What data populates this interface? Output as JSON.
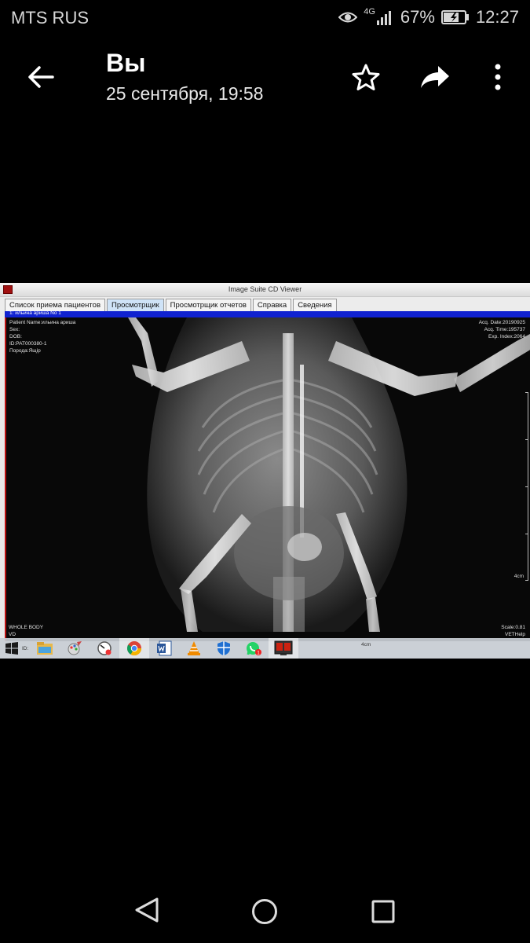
{
  "status_bar": {
    "carrier": "MTS RUS",
    "network": "4G",
    "battery": "67%",
    "time": "12:27"
  },
  "app_bar": {
    "title": "Вы",
    "subtitle": "25 сентября, 19:58",
    "icons": [
      "back-arrow-icon",
      "star-icon",
      "share-icon",
      "more-vert-icon"
    ]
  },
  "photo": {
    "window_title": "Image Suite CD Viewer",
    "tabs": [
      {
        "label": "Список приема пациентов"
      },
      {
        "label": "Просмотрщик"
      },
      {
        "label": "Просмотрщик отчетов"
      },
      {
        "label": "Справка"
      },
      {
        "label": "Сведения"
      }
    ],
    "active_tab": 1,
    "patient_strip": "1: ильина ариша     No 1",
    "overlay_left": {
      "patient_name": "Patient Name:ильина ариша",
      "sex": "Sex:",
      "dob": "DOB:",
      "id": "ID:PAT000380-1",
      "breed": "Порода:Ящір"
    },
    "overlay_right": {
      "acq_date": "Acq. Date:20190925",
      "acq_time": "Acq. Time:195737",
      "exp_index": "Exp. Index:2064"
    },
    "ruler_label": "4cm",
    "overlay_bottom_left": {
      "body_part": "WHOLE BODY",
      "view": "VD",
      "id_partial": "ID:"
    },
    "taskbar_time": "4cm",
    "overlay_bottom_right": {
      "scale": "Scale:0.81",
      "brand": "VETHelp"
    },
    "taskbar_icons": [
      "windows-start-icon",
      "file-explorer-icon",
      "paint-icon",
      "speedometer-icon",
      "chrome-icon",
      "word-icon",
      "vlc-icon",
      "defender-icon",
      "whatsapp-icon",
      "image-suite-icon"
    ]
  },
  "nav_bar": {
    "icons": [
      "nav-back-icon",
      "nav-home-icon",
      "nav-recent-icon"
    ]
  }
}
